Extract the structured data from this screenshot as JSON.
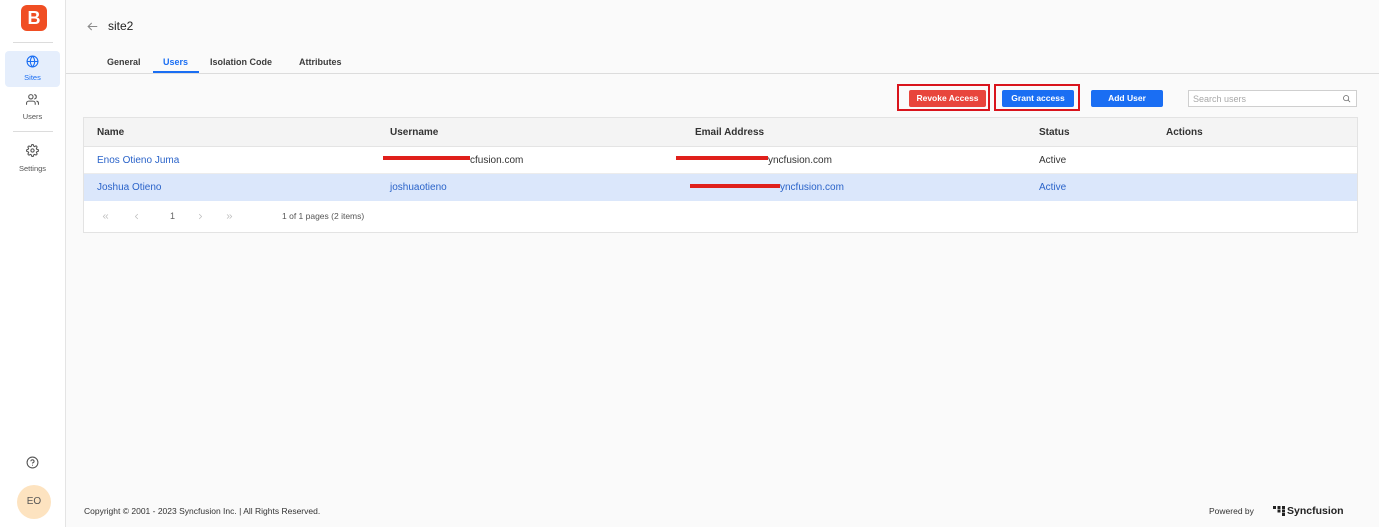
{
  "app": {
    "logo_letter": "B"
  },
  "sidebar": {
    "items": [
      {
        "label": "Sites",
        "icon": "globe-icon",
        "active": true
      },
      {
        "label": "Users",
        "icon": "users-icon",
        "active": false
      },
      {
        "label": "Settings",
        "icon": "gear-icon",
        "active": false
      }
    ],
    "help_icon": "help-circle-icon",
    "avatar": {
      "initials": "EO"
    }
  },
  "header": {
    "back_icon": "arrow-left-icon",
    "title": "site2"
  },
  "tabs": [
    {
      "label": "General",
      "active": false
    },
    {
      "label": "Users",
      "active": true
    },
    {
      "label": "Isolation Code",
      "active": false
    },
    {
      "label": "Attributes",
      "active": false
    }
  ],
  "toolbar": {
    "revoke_label": "Revoke Access",
    "revoke_highlighted": true,
    "grant_label": "Grant access",
    "grant_highlighted": true,
    "add_user_label": "Add User",
    "search_placeholder": "Search users",
    "search_icon": "search-icon"
  },
  "table": {
    "columns": [
      "Name",
      "Username",
      "Email Address",
      "Status",
      "Actions"
    ],
    "rows": [
      {
        "name": "Enos Otieno Juma",
        "username": "cfusion.com",
        "username_redacted": true,
        "email": "yncfusion.com",
        "email_redacted": true,
        "status": "Active",
        "selected": false
      },
      {
        "name": "Joshua Otieno",
        "username": "joshuaotieno",
        "username_redacted": false,
        "email": "yncfusion.com",
        "email_redacted": true,
        "status": "Active",
        "selected": true
      }
    ],
    "pager": {
      "icons": [
        "chevrons-left-icon",
        "chevron-left-icon",
        "chevron-right-icon",
        "chevrons-right-icon"
      ],
      "current_page": "1",
      "summary": "1 of 1 pages (2 items)"
    }
  },
  "footer": {
    "copyright": "Copyright © 2001 - 2023 Syncfusion Inc. | All Rights Reserved.",
    "powered_by": "Powered by",
    "brand": "Syncfusion"
  },
  "colors": {
    "accent": "#1a6ef3",
    "danger": "#e8453c",
    "annotation": "#d9141c",
    "redaction": "#e0201b",
    "selected_row": "#dbe7fb",
    "logo": "#f04e23",
    "avatar": "#fde3c0"
  }
}
